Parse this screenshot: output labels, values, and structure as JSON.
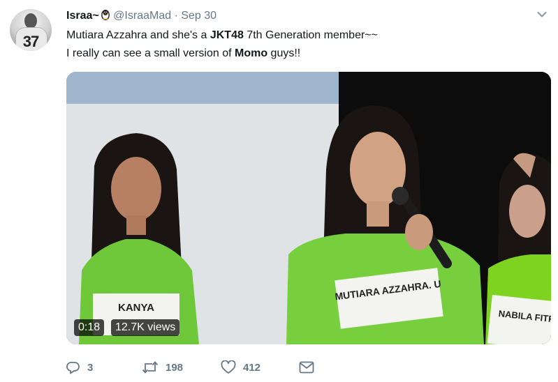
{
  "tweet": {
    "author_name": "Israa~",
    "author_handle": "@IsraaMad",
    "separator": "·",
    "date": "Sep 30",
    "avatar_number": "37",
    "text_line1_a": "Mutiara Azzahra and she's a ",
    "text_line1_bold": "JKT48",
    "text_line1_b": " 7th Generation member~~",
    "text_line2_a": "I really can see a small version of ",
    "text_line2_bold": "Momo",
    "text_line2_b": " guys!!"
  },
  "video": {
    "duration": "0:18",
    "views": "12.7K views",
    "name_tags": [
      "KANYA",
      "MUTIARA AZZAHRA. U",
      "NABILA FITRI"
    ]
  },
  "actions": {
    "replies": "3",
    "retweets": "198",
    "likes": "412"
  },
  "colors": {
    "text": "#14171a",
    "secondary": "#657786",
    "shirt_green": "#7ed321"
  },
  "icons": [
    "penguin-emoji-icon",
    "chevron-down-icon",
    "reply-icon",
    "retweet-icon",
    "like-icon",
    "direct-message-icon"
  ]
}
